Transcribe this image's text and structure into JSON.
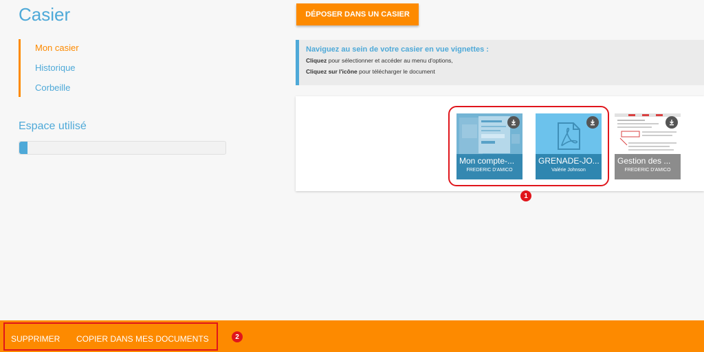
{
  "page": {
    "title": "Casier",
    "deposit_button": "DÉPOSER DANS UN CASIER"
  },
  "sidebar": {
    "items": [
      {
        "label": "Mon casier",
        "active": true
      },
      {
        "label": "Historique",
        "active": false
      },
      {
        "label": "Corbeille",
        "active": false
      }
    ],
    "space_title": "Espace utilisé",
    "space_used_fraction": 0.04
  },
  "info": {
    "title": "Naviguez au sein de votre casier en vue vignettes :",
    "line1_bold": "Cliquez",
    "line1_rest": " pour sélectionner et accéder au menu d'options,",
    "line2_bold": "Cliquez sur l'icône",
    "line2_rest": " pour télécharger le document"
  },
  "thumbnails": [
    {
      "title": "Mon compte-...",
      "author": "FREDERIC D'AMICO",
      "icon": "download-icon"
    },
    {
      "title": "GRENADE-JO...",
      "author": "Valérie Johnson",
      "icon": "download-icon"
    },
    {
      "title": "Gestion des ...",
      "author": "FREDERIC D'AMICO",
      "icon": "download-icon"
    }
  ],
  "markers": [
    "1",
    "2"
  ],
  "actions": {
    "delete_label": "SUPPRIMER",
    "copy_label": "COPIER DANS MES DOCUMENTS"
  },
  "colors": {
    "accent_orange": "#fd8a00",
    "accent_blue": "#4ea9d8",
    "annotation_red": "#e0151b",
    "selected_thumb": "#4ea9d8",
    "unselected_caption": "#8c8c8c"
  }
}
